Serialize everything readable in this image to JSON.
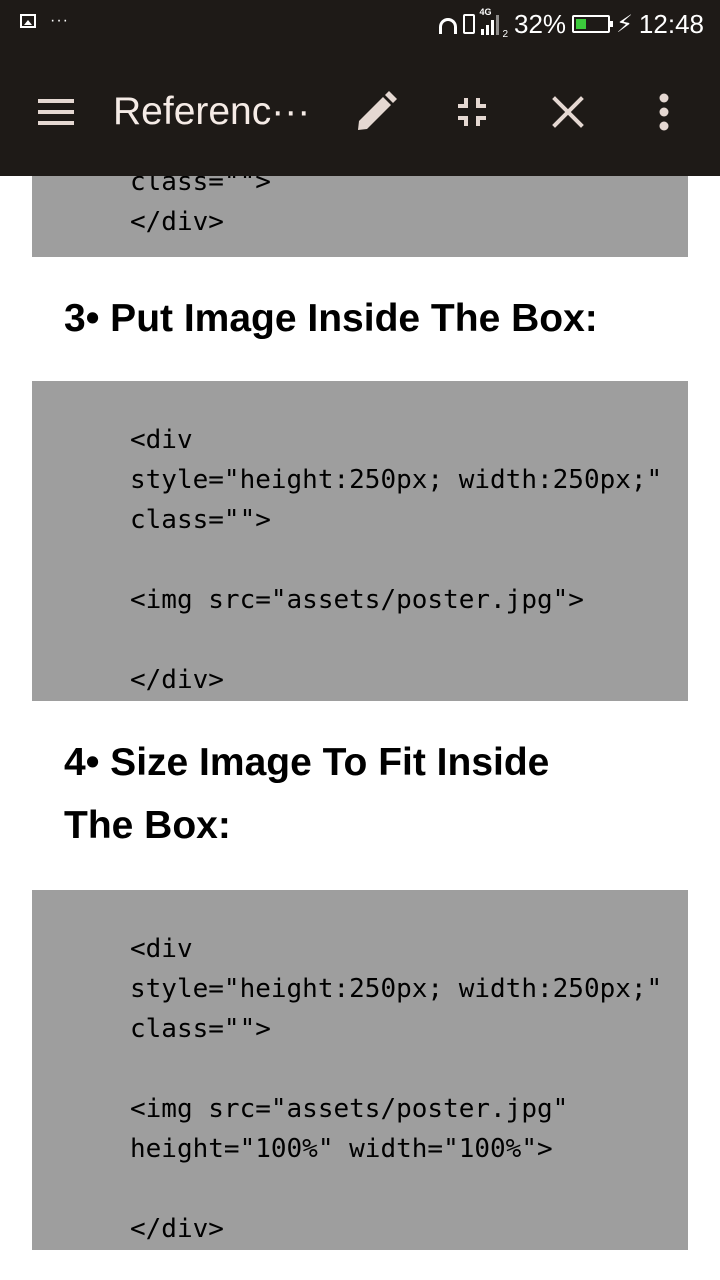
{
  "status_bar": {
    "network": "4G",
    "sim": "2",
    "battery_percent": "32%",
    "battery_level": 0.32,
    "battery_color": "#3cc93c",
    "charging_icon": "lightning-icon",
    "time": "12:48",
    "notification_icons": [
      "image-icon",
      "more-notifications-icon"
    ],
    "system_icons": [
      "headphones-icon",
      "vibrate-icon",
      "signal-icon",
      "battery-icon"
    ]
  },
  "app_bar": {
    "background": "#1e1a17",
    "title": "Referenc···",
    "icons": [
      "menu-icon",
      "edit-icon",
      "collapse-icon",
      "close-icon",
      "more-vert-icon"
    ]
  },
  "content": {
    "block1": {
      "lines": [
        "class=\"\">",
        "</div>"
      ]
    },
    "heading3": "3• Put Image Inside The Box:",
    "block2": {
      "lines": [
        "<div",
        "style=\"height:250px; width:250px;\"",
        "class=\"\">",
        "",
        "<img src=\"assets/poster.jpg\">",
        "",
        "</div>"
      ]
    },
    "heading4_line1": "4• Size Image To Fit Inside",
    "heading4_line2": "The Box:",
    "block3": {
      "lines": [
        "<div",
        "style=\"height:250px; width:250px;\"",
        "class=\"\">",
        "",
        "<img src=\"assets/poster.jpg\"",
        "height=\"100%\" width=\"100%\">",
        "",
        "</div>"
      ]
    },
    "code_background": "#9e9e9e"
  }
}
